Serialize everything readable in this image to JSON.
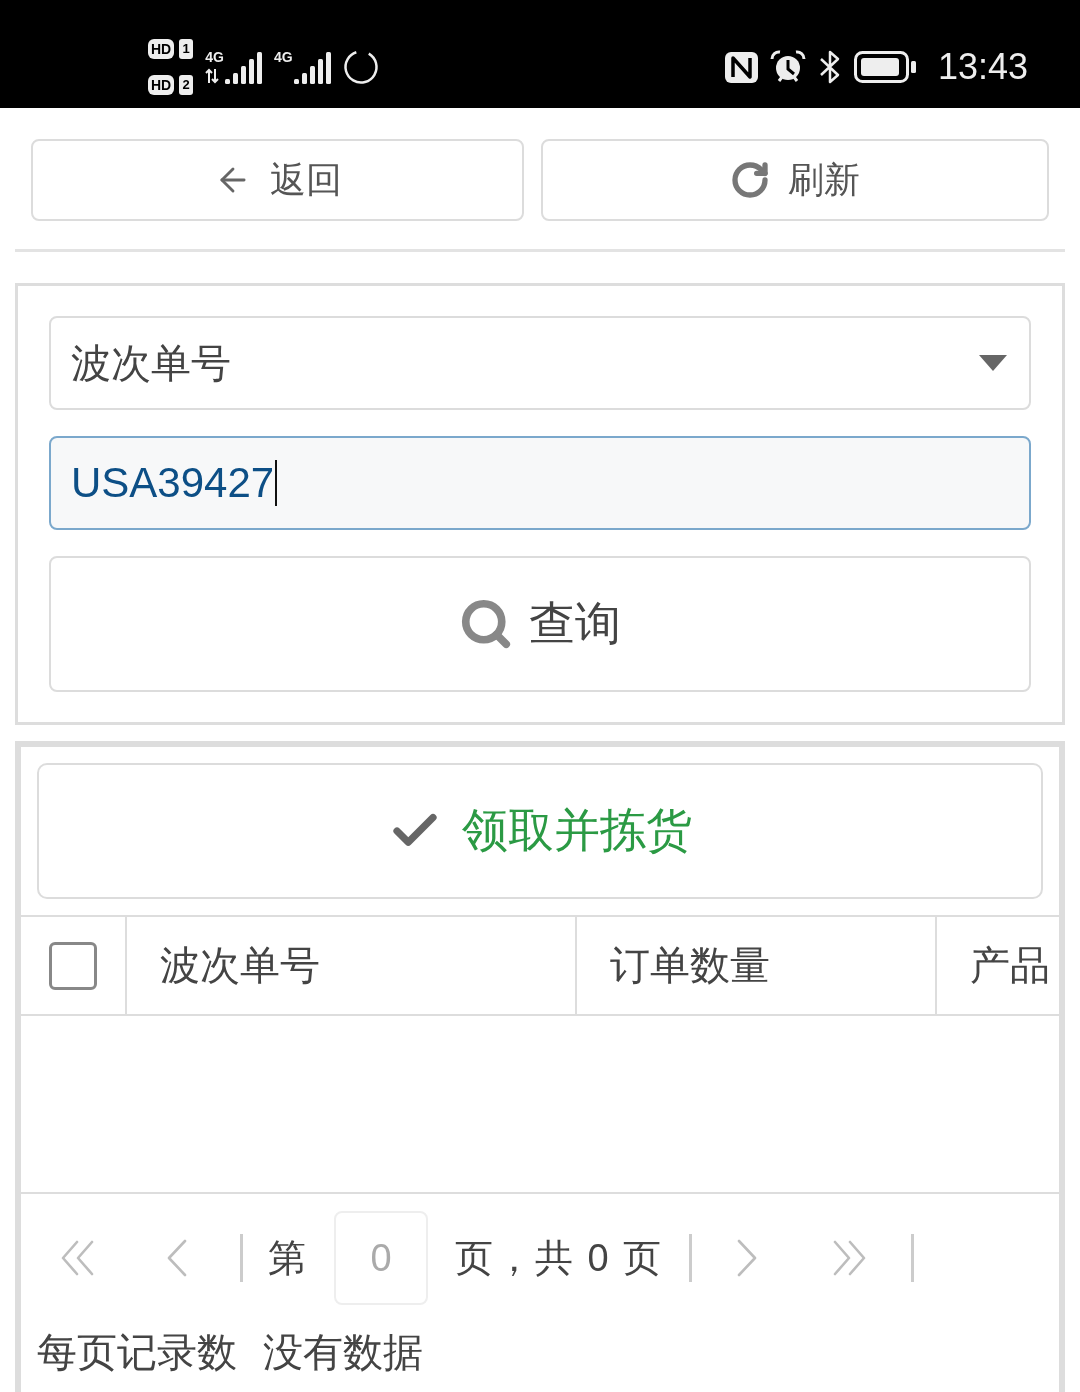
{
  "status_bar": {
    "sims": [
      {
        "badge": "HD",
        "slot": "1"
      },
      {
        "badge": "HD",
        "slot": "2"
      }
    ],
    "networks": [
      {
        "type": "4G",
        "kind": "data"
      },
      {
        "type": "4G",
        "kind": "plain"
      }
    ],
    "time": "13:43"
  },
  "toolbar": {
    "buttons": [
      {
        "kind": "back",
        "label": "返回"
      },
      {
        "kind": "refresh",
        "label": "刷新"
      }
    ]
  },
  "search": {
    "field_select": {
      "value": "波次单号"
    },
    "input": {
      "value": "USA39427",
      "focused": true
    },
    "button": {
      "label": "查询"
    }
  },
  "picking": {
    "button": {
      "label": "领取并拣货"
    }
  },
  "table": {
    "select_all": {
      "checked": false
    },
    "columns": [
      "波次单号",
      "订单数量",
      "产品"
    ]
  },
  "pager": {
    "buttons": [
      {
        "kind": "first",
        "disabled": true
      },
      {
        "kind": "prev",
        "disabled": true
      },
      {
        "kind": "next",
        "disabled": true
      },
      {
        "kind": "last",
        "disabled": true
      }
    ],
    "page_prefix": "第",
    "page_input": {
      "value": "0",
      "disabled": true
    },
    "page_suffix": "页，共 0 页",
    "page_size_label": "每页记录数",
    "page_size_value": "没有数据"
  }
}
